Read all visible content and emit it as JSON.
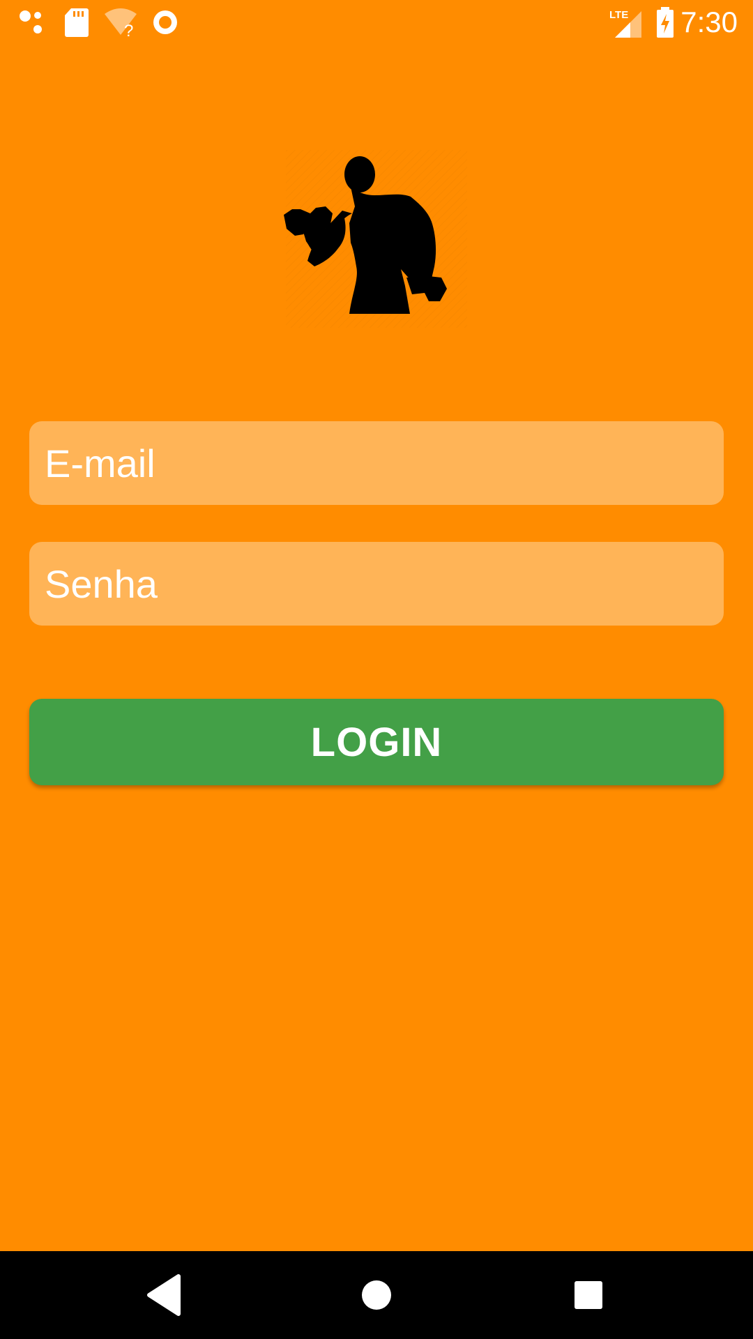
{
  "status_bar": {
    "time": "7:30",
    "network_label": "LTE",
    "icons": [
      "assistant-dots-icon",
      "sd-card-icon",
      "wifi-unknown-icon",
      "sync-circle-icon",
      "lte-signal-icon",
      "battery-charging-icon"
    ]
  },
  "logo": {
    "icon": "bodybuilder-dumbbell-icon"
  },
  "login_form": {
    "email_placeholder": "E-mail",
    "email_value": "",
    "password_placeholder": "Senha",
    "password_value": "",
    "login_label": "LOGIN"
  },
  "nav_bar": {
    "icons": [
      "back-icon",
      "home-icon",
      "recents-icon"
    ]
  },
  "colors": {
    "background": "#FF8C00",
    "input_background": "#FFB457",
    "button_green": "#43A047",
    "text": "#FFFFFF"
  }
}
